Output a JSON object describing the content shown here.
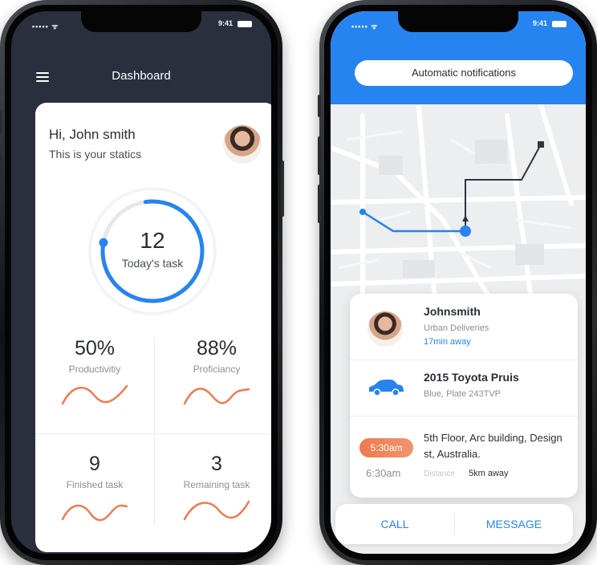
{
  "colors": {
    "accent": "#2684f0",
    "dark_header": "#2a2f3e",
    "chart_line": "#f07a4f",
    "pill": "#f07a4f"
  },
  "left_phone": {
    "status": {
      "signal": "••••• ᯤ",
      "time": "9:41"
    },
    "header": {
      "menu_icon": "hamburger-icon",
      "title": "Dashboard"
    },
    "greeting": {
      "title": "Hi, John smith",
      "subtitle": "This is your statics"
    },
    "avatar_icon": "user-avatar",
    "progress": {
      "value": "12",
      "label": "Today's task",
      "fraction": 0.8
    },
    "stats": [
      {
        "value": "50%",
        "label": "Productivitiy"
      },
      {
        "value": "88%",
        "label": "Proficiancy"
      },
      {
        "value": "9",
        "label": "Finished task"
      },
      {
        "value": "3",
        "label": "Remaining task"
      }
    ]
  },
  "right_phone": {
    "status": {
      "signal": "••••• ᯤ",
      "time": "9:41"
    },
    "notification": "Automatic notifications",
    "driver": {
      "name": "Johnsmith",
      "company": "Urban Deliveries",
      "eta": "17min away"
    },
    "car": {
      "model": "2015 Toyota Pruis",
      "description": "Blue, Plate 243TVP",
      "icon": "car-icon"
    },
    "trip": {
      "pickup_time": "5:30am",
      "dropoff_time": "6:30am",
      "address": "5th Floor, Arc building, Design st, Australia.",
      "distance_label": "Distance",
      "distance_value": "5km away"
    },
    "actions": {
      "call": "CALL",
      "message": "MESSAGE"
    }
  }
}
